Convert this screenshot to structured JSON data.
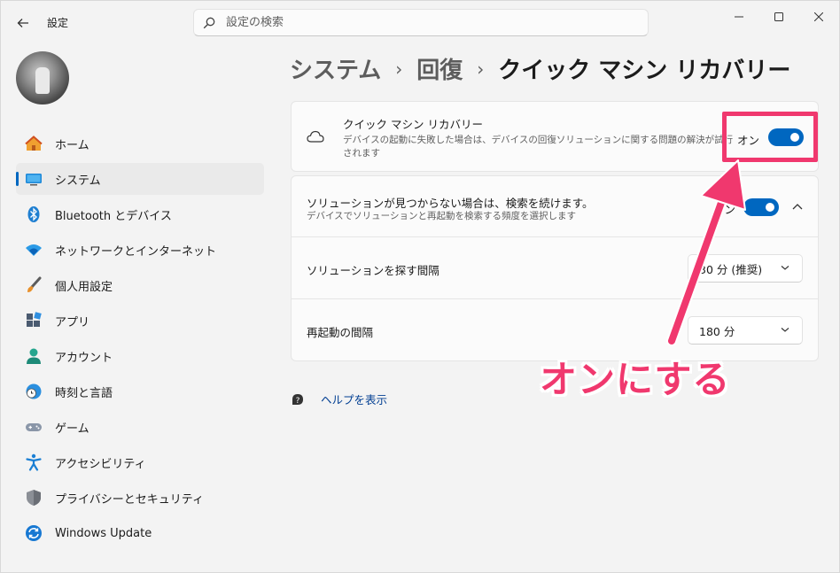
{
  "window": {
    "title": "設定",
    "minimize": "—",
    "maximize": "☐",
    "close": "✕"
  },
  "search": {
    "placeholder": "設定の検索"
  },
  "sidebar": {
    "items": [
      {
        "label": "ホーム",
        "icon": "home-icon",
        "active": false
      },
      {
        "label": "システム",
        "icon": "system-icon",
        "active": true
      },
      {
        "label": "Bluetooth とデバイス",
        "icon": "bluetooth-icon",
        "active": false
      },
      {
        "label": "ネットワークとインターネット",
        "icon": "wifi-icon",
        "active": false
      },
      {
        "label": "個人用設定",
        "icon": "brush-icon",
        "active": false
      },
      {
        "label": "アプリ",
        "icon": "apps-icon",
        "active": false
      },
      {
        "label": "アカウント",
        "icon": "account-icon",
        "active": false
      },
      {
        "label": "時刻と言語",
        "icon": "clock-globe-icon",
        "active": false
      },
      {
        "label": "ゲーム",
        "icon": "gamepad-icon",
        "active": false
      },
      {
        "label": "アクセシビリティ",
        "icon": "accessibility-icon",
        "active": false
      },
      {
        "label": "プライバシーとセキュリティ",
        "icon": "shield-icon",
        "active": false
      },
      {
        "label": "Windows Update",
        "icon": "update-icon",
        "active": false
      }
    ]
  },
  "breadcrumb": {
    "part1": "システム",
    "part2": "回復",
    "current": "クイック マシン リカバリー",
    "sep": "›"
  },
  "card_qmr": {
    "title": "クイック マシン リカバリー",
    "desc_line1": "デバイスの起動に失敗した場合は、デバイスの回復ソリューションに関する問題の解決が試行",
    "desc_line2": "されます",
    "state_label": "オン",
    "toggle_on": true
  },
  "card_continue": {
    "title": "ソリューションが見つからない場合は、検索を続けます。",
    "desc": "デバイスでソリューションと再起動を検索する頻度を選択します",
    "state_label": "オン",
    "toggle_on": true
  },
  "row_interval": {
    "label": "ソリューションを探す間隔",
    "value": "30 分 (推奨)"
  },
  "row_restart": {
    "label": "再起動の間隔",
    "value": "180 分"
  },
  "help": {
    "label": "ヘルプを表示"
  },
  "annotation": {
    "text": "オンにする",
    "color": "#f0386e"
  },
  "colors": {
    "accent": "#0067c0",
    "link": "#003e92"
  }
}
